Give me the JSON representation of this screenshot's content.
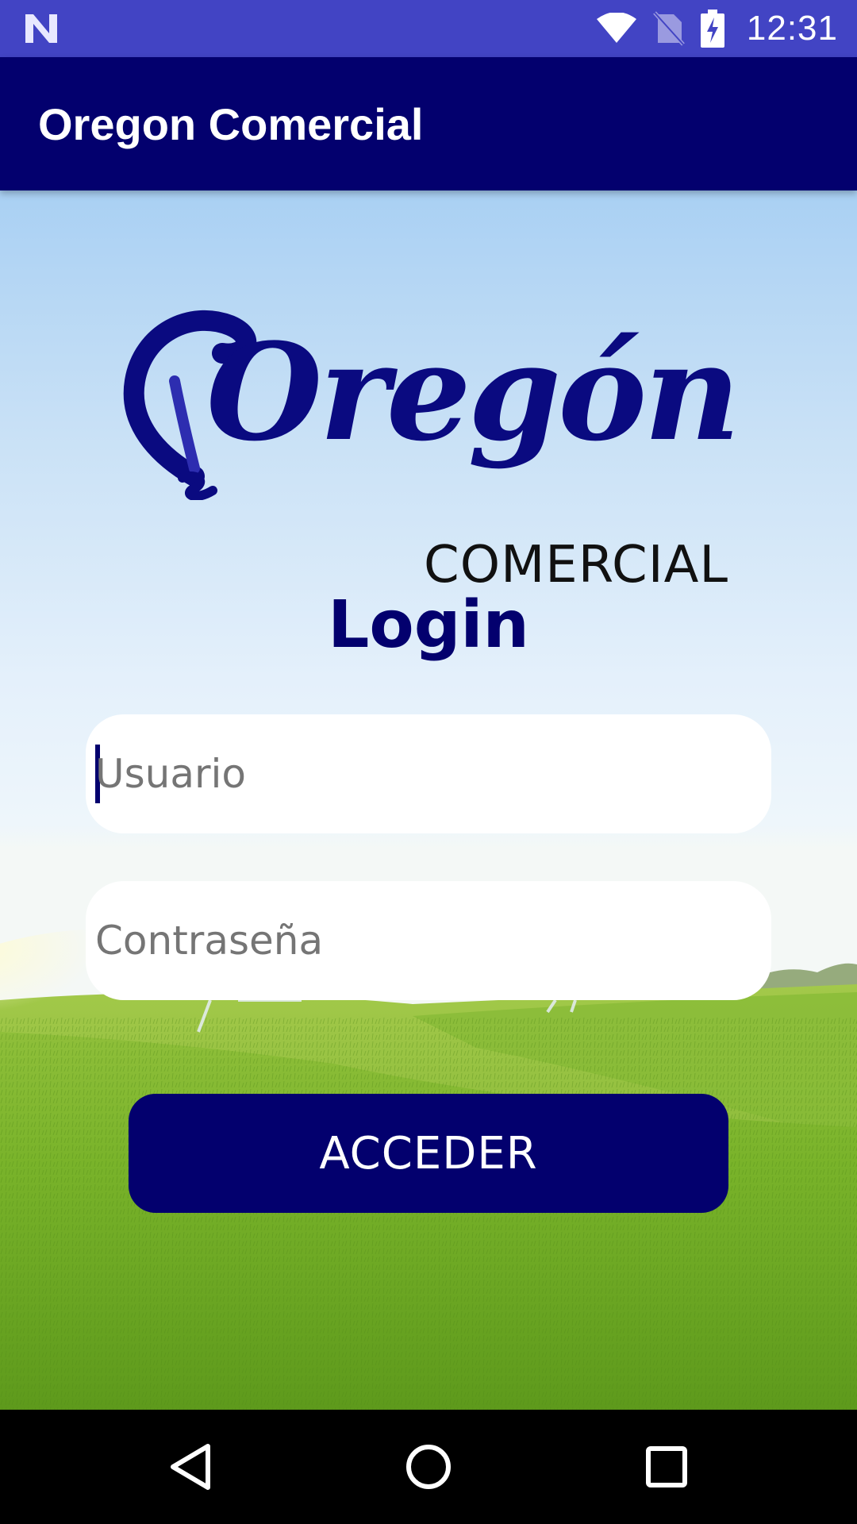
{
  "status_bar": {
    "time": "12:31",
    "icons": [
      "notification-n-icon",
      "wifi-icon",
      "no-sim-icon",
      "battery-charging-icon"
    ],
    "background_color": "#4244c4"
  },
  "app_bar": {
    "title": "Oregon Comercial",
    "background_color": "#03006e"
  },
  "logo": {
    "script_text": "Oregón",
    "sub_text": "COMERCIAL",
    "icon": "lightbulb-logo-icon"
  },
  "login": {
    "title": "Login",
    "username": {
      "placeholder": "Usuario",
      "value": ""
    },
    "password": {
      "placeholder": "Contraseña",
      "value": ""
    },
    "submit_label": "ACCEDER",
    "accent_color": "#03006e"
  },
  "nav_bar": {
    "buttons": [
      "back-icon",
      "home-icon",
      "recents-icon"
    ]
  }
}
